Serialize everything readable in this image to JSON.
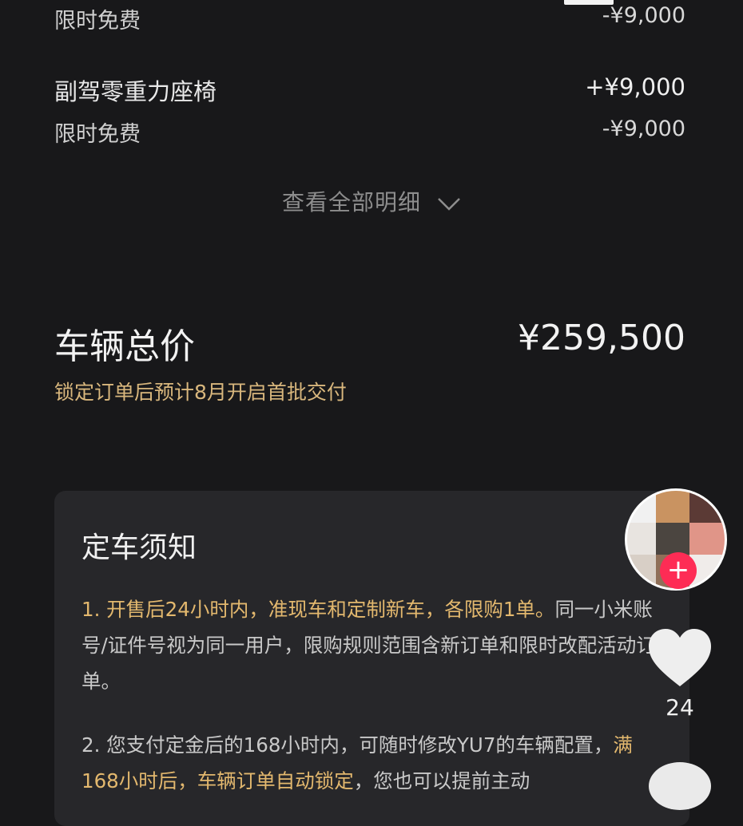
{
  "options": [
    {
      "type": "sub",
      "label": "限时免费",
      "price": "-¥9,000"
    },
    {
      "type": "main",
      "label": "副驾零重力座椅",
      "price": "+¥9,000"
    },
    {
      "type": "sub",
      "label": "限时免费",
      "price": "-¥9,000"
    }
  ],
  "detail_link": "查看全部明细",
  "total": {
    "label": "车辆总价",
    "value": "¥259,500"
  },
  "delivery_notice": "锁定订单后预计8月开启首批交付",
  "booking_card": {
    "title": "定车须知",
    "item1_highlight": "1. 开售后24小时内，准现车和定制新车，各限购1单。",
    "item1_rest": "同一小米账号/证件号视为同一用户，限购规则范围含新订单和限时改配活动订单。",
    "item2_start": "2. 您支付定金后的168小时内，可随时修改YU7的车辆配置，",
    "item2_highlight": "满168小时后，车辆订单自动锁定",
    "item2_end": "，您也可以提前主动"
  },
  "side_actions": {
    "like_count": "24"
  },
  "colors": {
    "background": "#18181a",
    "accent_gold": "#d9b77d",
    "card": "#27272a",
    "follow_red": "#fe2c55"
  },
  "icons": [
    "chevron-down-icon",
    "plus-icon",
    "heart-icon"
  ]
}
